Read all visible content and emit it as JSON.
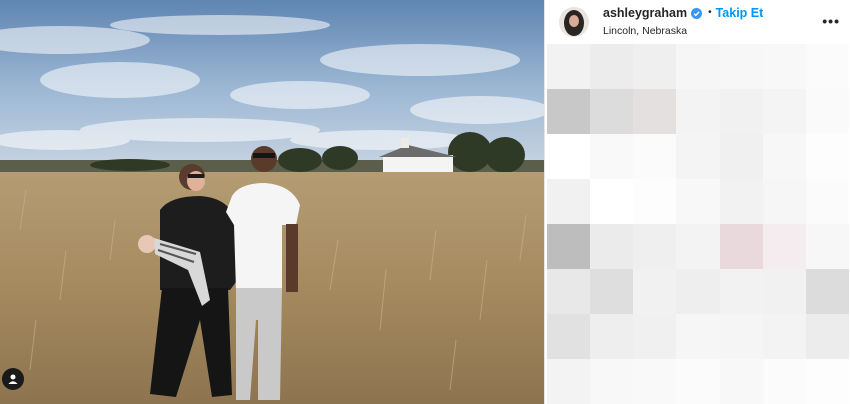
{
  "post": {
    "username": "ashleygraham",
    "separator": "•",
    "follow_label": "Takip Et",
    "location": "Lincoln, Nebraska",
    "more_glyph": "•••",
    "icons": {
      "verified": "verified-badge-icon",
      "tag": "user-tag-icon",
      "more": "more-options-icon"
    },
    "colors": {
      "accent": "#0095f6",
      "text": "#262626"
    },
    "blurred_comments": [
      [
        "#f2f2f2",
        "#ececec",
        "#efefef",
        "#f6f6f6",
        "#f7f7f7",
        "#f8f8f8",
        "#fbfbfb"
      ],
      [
        "#c8c8c8",
        "#dcdcdc",
        "#e4e0e0",
        "#f3f3f3",
        "#f1f1f1",
        "#f4f4f4",
        "#fafafa"
      ],
      [
        "#ffffff",
        "#f9f9f9",
        "#fbfbfb",
        "#f4f4f4",
        "#f0f0f0",
        "#f7f7f7",
        "#fdfdfd"
      ],
      [
        "#f1f1f1",
        "#ffffff",
        "#fdfdfd",
        "#f8f8f8",
        "#f2f2f2",
        "#f6f6f6",
        "#fbfbfb"
      ],
      [
        "#bdbdbd",
        "#ebebeb",
        "#efefef",
        "#f3f3f3",
        "#ead9dc",
        "#f4ecee",
        "#f7f7f7"
      ],
      [
        "#e8e8e8",
        "#dedede",
        "#f1f1f1",
        "#eeeeee",
        "#f2f2f2",
        "#f1f1f1",
        "#dcdcdc"
      ],
      [
        "#e1e1e1",
        "#eeeeee",
        "#f0f0f0",
        "#f6f6f6",
        "#f5f5f5",
        "#f3f3f3",
        "#ececec"
      ],
      [
        "#f3f3f3",
        "#f8f8f8",
        "#f9f9f9",
        "#fbfbfb",
        "#f8f8f8",
        "#fbfbfb",
        "#fdfdfd"
      ]
    ]
  }
}
